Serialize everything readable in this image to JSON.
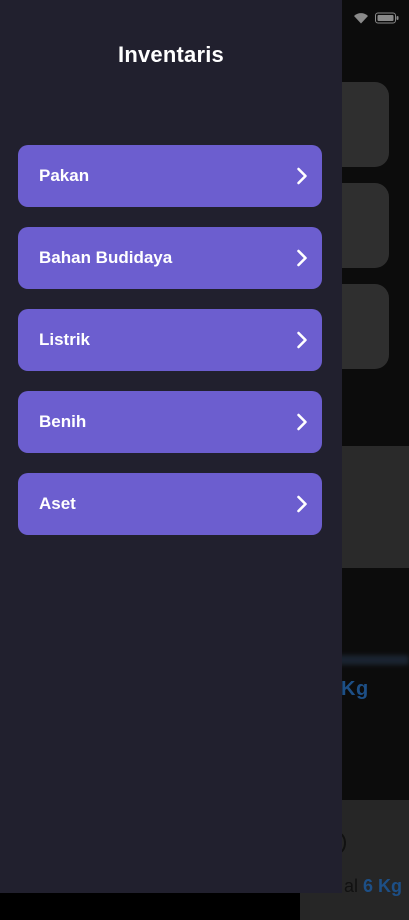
{
  "drawer": {
    "title": "Inventaris",
    "items": [
      {
        "label": "Pakan",
        "icon": "chevron-right-icon"
      },
      {
        "label": "Bahan Budidaya",
        "icon": "chevron-right-icon"
      },
      {
        "label": "Listrik",
        "icon": "chevron-right-icon"
      },
      {
        "label": "Benih",
        "icon": "chevron-right-icon"
      },
      {
        "label": "Aset",
        "icon": "chevron-right-icon"
      }
    ]
  },
  "background": {
    "value_text": "Kg",
    "bottom_text_prefix": "al",
    "bottom_text_value": "6 Kg"
  },
  "colors": {
    "drawer_bg": "#21202e",
    "menu_item_bg": "#6c5ecf",
    "scrim": "#0c0c0c",
    "accent_text": "#1d4f86"
  }
}
